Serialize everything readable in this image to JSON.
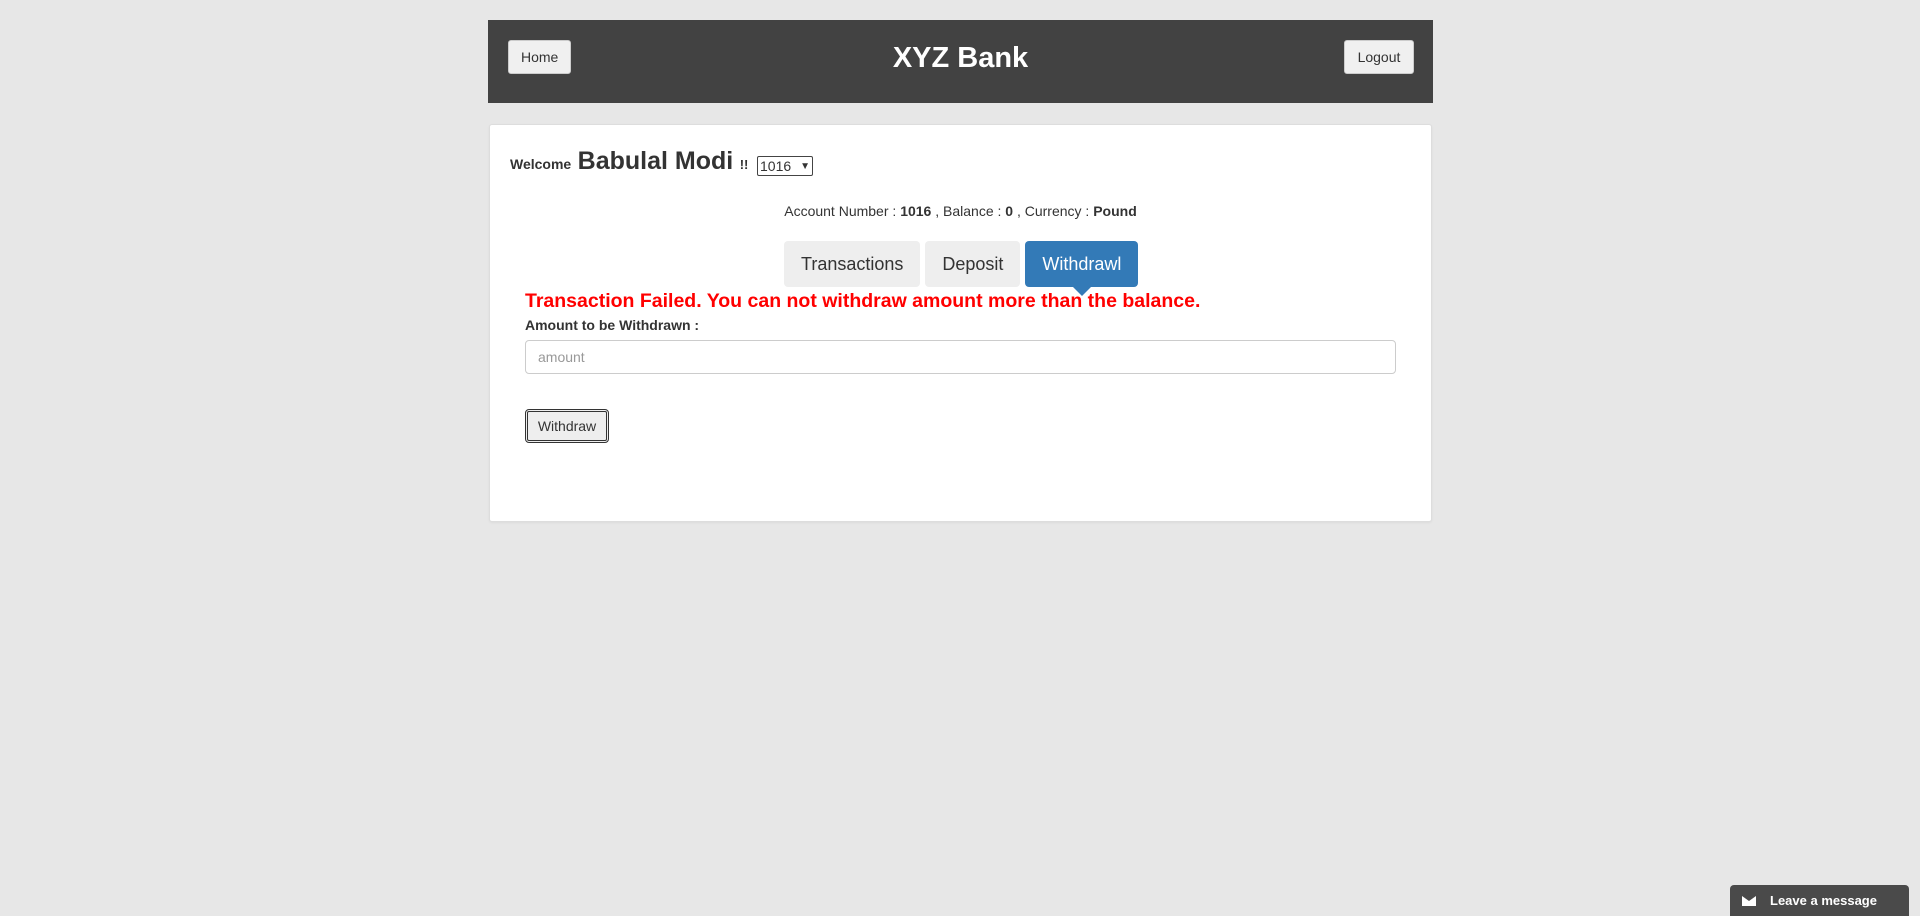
{
  "header": {
    "home_label": "Home",
    "title": "XYZ Bank",
    "logout_label": "Logout"
  },
  "welcome": {
    "prefix": "Welcome",
    "name": "Babulal Modi",
    "suffix": "!!"
  },
  "account_select": {
    "selected": "1016"
  },
  "account_info": {
    "account_number_label": "Account Number :",
    "account_number": "1016",
    "balance_label": ", Balance :",
    "balance": "0",
    "currency_label": ", Currency :",
    "currency": "Pound"
  },
  "tabs": [
    {
      "label": "Transactions",
      "active": false
    },
    {
      "label": "Deposit",
      "active": false
    },
    {
      "label": "Withdrawl",
      "active": true
    }
  ],
  "withdraw_form": {
    "error_message": "Transaction Failed. You can not withdraw amount more than the balance.",
    "amount_label": "Amount to be Withdrawn :",
    "amount_value": "",
    "amount_placeholder": "amount",
    "submit_label": "Withdraw"
  },
  "chat_widget": {
    "label": "Leave a message",
    "icon": "envelope-icon"
  },
  "colors": {
    "header_bg": "#424242",
    "active_tab": "#337ab7",
    "error": "#ff0000",
    "page_bg": "#e7e7e7"
  }
}
